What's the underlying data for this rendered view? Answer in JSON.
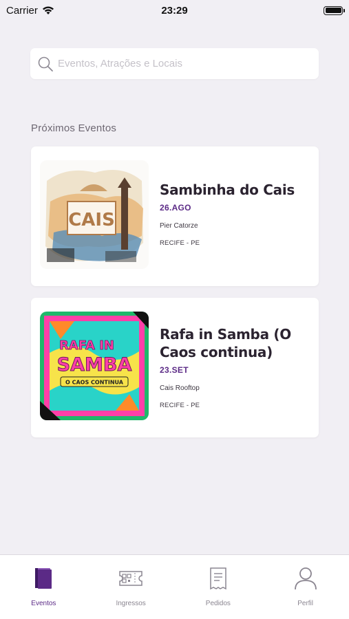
{
  "status_bar": {
    "carrier": "Carrier",
    "time": "23:29"
  },
  "search": {
    "placeholder": "Eventos, Atrações e Locais",
    "value": ""
  },
  "section": {
    "title": "Próximos Eventos"
  },
  "events": [
    {
      "title": "Sambinha do Cais",
      "date": "26.AGO",
      "venue": "Pier Catorze",
      "city": "RECIFE - PE",
      "image_text": "CAIS"
    },
    {
      "title": "Rafa in Samba (O Caos continua)",
      "date": "23.SET",
      "venue": "Cais Rooftop",
      "city": "RECIFE - PE",
      "image_text_1": "RAFA IN",
      "image_text_2": "SAMBA",
      "image_text_3": "O CAOS CONTINUA"
    }
  ],
  "tab_bar": {
    "items": [
      {
        "label": "Eventos",
        "icon": "calendar-book-icon",
        "active": true
      },
      {
        "label": "Ingressos",
        "icon": "ticket-qr-icon",
        "active": false
      },
      {
        "label": "Pedidos",
        "icon": "receipt-icon",
        "active": false
      },
      {
        "label": "Perfil",
        "icon": "person-icon",
        "active": false
      }
    ]
  },
  "colors": {
    "accent": "#5b2a86",
    "background": "#f1eff4",
    "card": "#ffffff"
  }
}
